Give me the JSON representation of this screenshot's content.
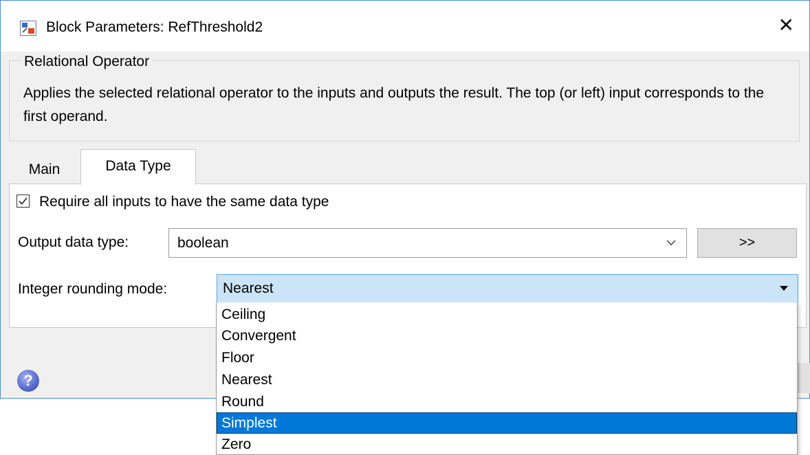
{
  "window": {
    "title": "Block Parameters: RefThreshold2",
    "close_label": "✕"
  },
  "group": {
    "title": "Relational Operator",
    "description": "Applies the selected relational operator to the inputs and outputs the result. The top (or left) input corresponds to the first operand."
  },
  "tabs": [
    {
      "label": "Main",
      "active": false
    },
    {
      "label": "Data Type",
      "active": true
    }
  ],
  "datatype": {
    "require_same_checked": true,
    "require_same_label": "Require all inputs to have the same data type",
    "output_label": "Output data type:",
    "output_value": "boolean",
    "assistant_button": ">>",
    "rounding_label": "Integer rounding mode:",
    "rounding_value": "Nearest",
    "rounding_options": [
      "Ceiling",
      "Convergent",
      "Floor",
      "Nearest",
      "Round",
      "Simplest",
      "Zero"
    ],
    "highlighted_option": "Simplest"
  },
  "help_label": "?",
  "colors": {
    "accent": "#0078d7",
    "select_bg": "#cce4f7",
    "window_bg": "#f0f0f0"
  }
}
